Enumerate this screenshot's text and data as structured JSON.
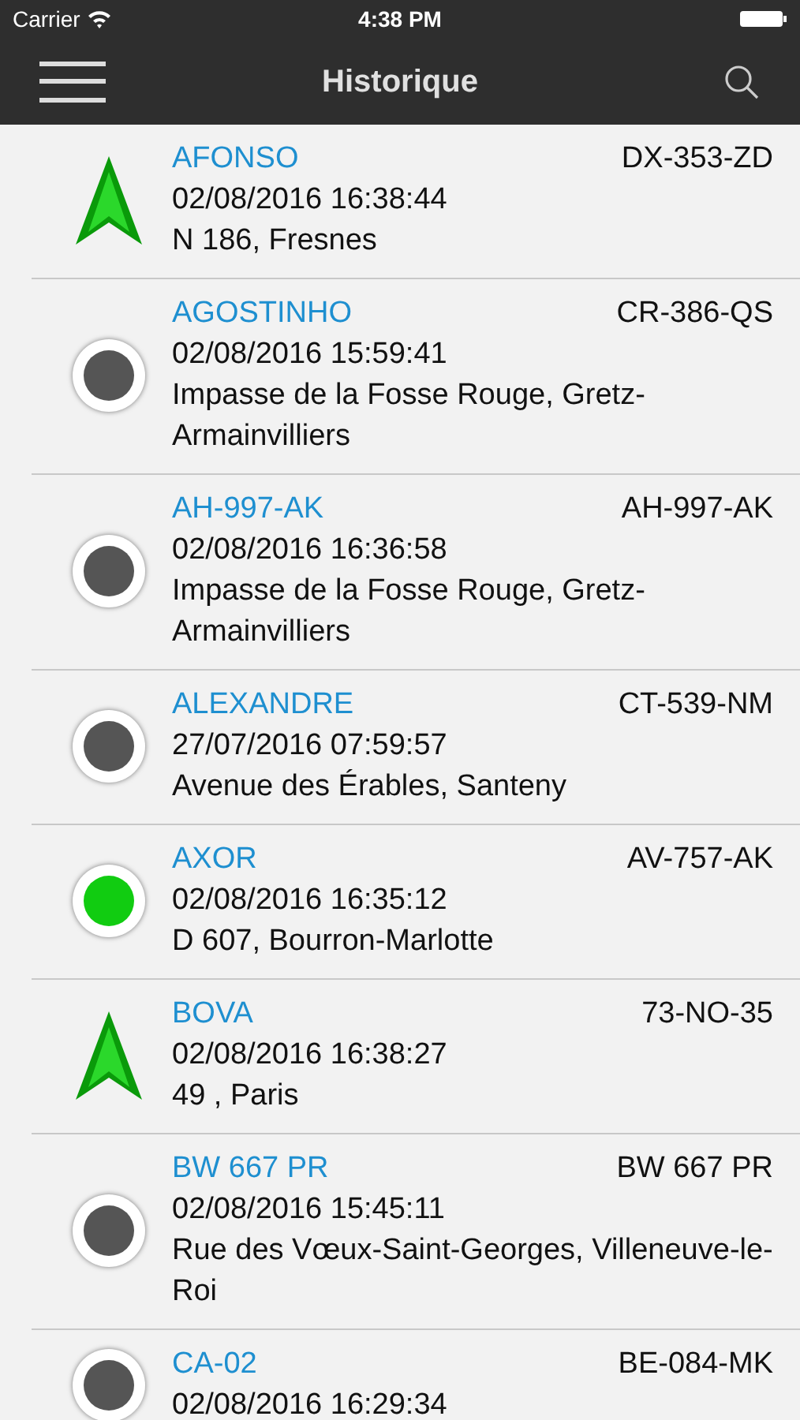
{
  "status_bar": {
    "carrier": "Carrier",
    "time": "4:38 PM"
  },
  "nav": {
    "title": "Historique"
  },
  "vehicles": [
    {
      "kind": "arrow",
      "name": "AFONSO",
      "plate": "DX-353-ZD",
      "datetime": "02/08/2016 16:38:44",
      "address": "N 186, Fresnes"
    },
    {
      "kind": "dot",
      "color": "#555555",
      "name": "AGOSTINHO",
      "plate": "CR-386-QS",
      "datetime": "02/08/2016 15:59:41",
      "address": "Impasse de la Fosse Rouge, Gretz-Armainvilliers"
    },
    {
      "kind": "dot",
      "color": "#555555",
      "name": "AH-997-AK",
      "plate": "AH-997-AK",
      "datetime": "02/08/2016 16:36:58",
      "address": "Impasse de la Fosse Rouge, Gretz-Armainvilliers"
    },
    {
      "kind": "dot",
      "color": "#555555",
      "name": "ALEXANDRE",
      "plate": "CT-539-NM",
      "datetime": "27/07/2016 07:59:57",
      "address": "Avenue des Érables, Santeny"
    },
    {
      "kind": "dot",
      "color": "#11cc11",
      "name": "AXOR",
      "plate": "AV-757-AK",
      "datetime": "02/08/2016 16:35:12",
      "address": "D 607, Bourron-Marlotte"
    },
    {
      "kind": "arrow",
      "name": "BOVA",
      "plate": "73-NO-35",
      "datetime": "02/08/2016 16:38:27",
      "address": "49 , Paris"
    },
    {
      "kind": "dot",
      "color": "#555555",
      "name": "BW 667 PR",
      "plate": "BW 667 PR",
      "datetime": "02/08/2016 15:45:11",
      "address": "Rue des Vœux-Saint-Georges, Villeneuve-le-Roi"
    },
    {
      "kind": "dot",
      "color": "#555555",
      "name": "CA-02",
      "plate": "BE-084-MK",
      "datetime": "02/08/2016 16:29:34"
    }
  ]
}
